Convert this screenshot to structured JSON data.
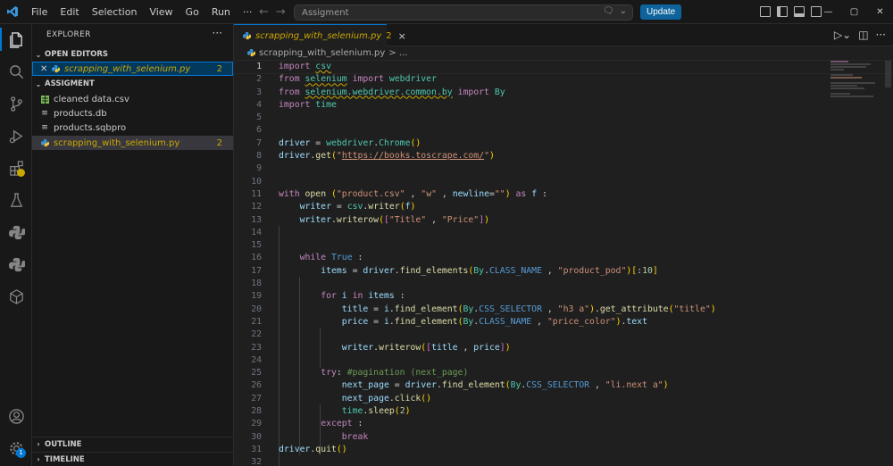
{
  "titlebar": {
    "menu": [
      "File",
      "Edit",
      "Selection",
      "View",
      "Go",
      "Run",
      "···"
    ],
    "search_text": "Assigment",
    "update_label": "Update"
  },
  "sidebar": {
    "title": "EXPLORER",
    "more": "···",
    "open_editors": {
      "label": "OPEN EDITORS",
      "items": [
        {
          "name": "scrapping_with_selenium.py",
          "count": "2"
        }
      ]
    },
    "folder": {
      "label": "ASSIGMENT",
      "files": [
        {
          "name": "cleaned data.csv",
          "count": ""
        },
        {
          "name": "products.db",
          "count": ""
        },
        {
          "name": "products.sqbpro",
          "count": ""
        },
        {
          "name": "scrapping_with_selenium.py",
          "count": "2"
        }
      ]
    },
    "outline_label": "OUTLINE",
    "timeline_label": "TIMELINE"
  },
  "activity": {
    "settings_badge": "1"
  },
  "editor": {
    "tab": {
      "name": "scrapping_with_selenium.py",
      "count": "2",
      "close": "×"
    },
    "breadcrumb": {
      "file": "scrapping_with_selenium.py",
      "tail": "> ..."
    },
    "line_numbers": [
      "1",
      "2",
      "3",
      "4",
      "5",
      "6",
      "7",
      "8",
      "9",
      "10",
      "11",
      "12",
      "13",
      "14",
      "15",
      "16",
      "17",
      "18",
      "19",
      "20",
      "21",
      "22",
      "23",
      "24",
      "25",
      "26",
      "27",
      "28",
      "29",
      "30",
      "31",
      "32"
    ]
  },
  "colors": {
    "accent": "#0078d4",
    "warning": "#cca700",
    "keyword": "#c586c0",
    "string": "#ce9178",
    "function": "#dcdcaa"
  }
}
